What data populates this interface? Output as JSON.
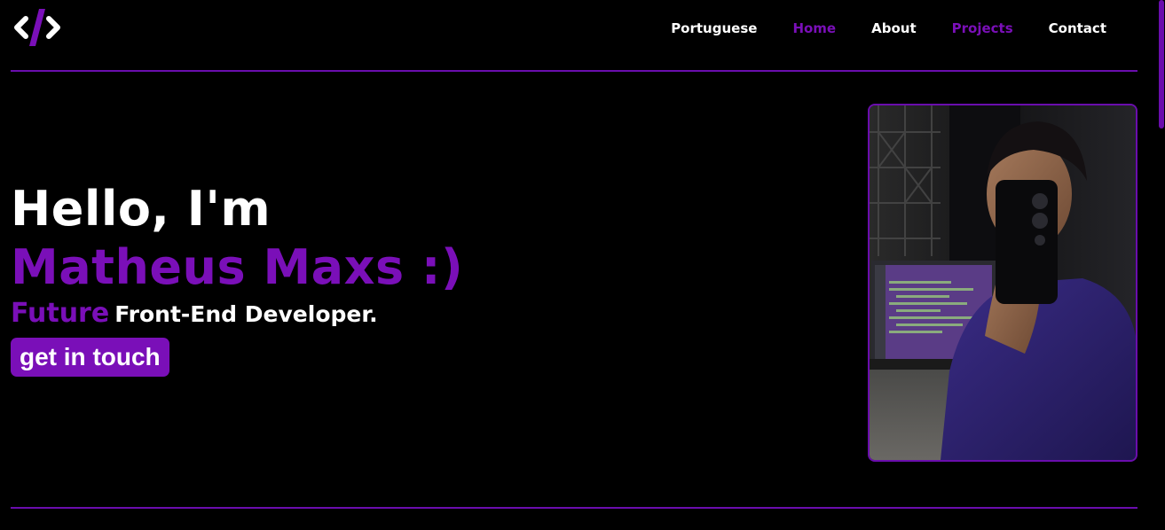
{
  "header": {
    "logo_icon": "code-brackets-icon",
    "nav": [
      {
        "label": "Portuguese",
        "color": "#ffffff"
      },
      {
        "label": "Home",
        "color": "#7a0fb8"
      },
      {
        "label": "About",
        "color": "#ffffff"
      },
      {
        "label": "Projects",
        "color": "#7a0fb8"
      },
      {
        "label": "Contact",
        "color": "#ffffff"
      }
    ]
  },
  "hero": {
    "greeting": "Hello, I'm",
    "name": "Matheus Maxs :)",
    "subtitle_accent": "Future",
    "subtitle_rest": "Front-End Developer.",
    "cta_label": "get in touch"
  },
  "colors": {
    "accent": "#7a0fb8",
    "background": "#000000",
    "text": "#ffffff"
  }
}
